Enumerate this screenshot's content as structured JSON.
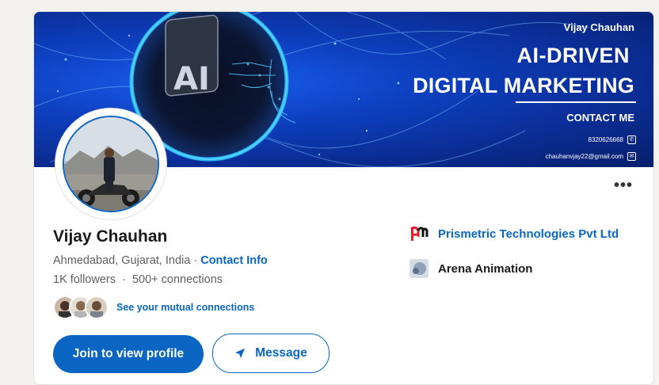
{
  "banner": {
    "name": "Vijay Chauhan",
    "title_line1": "AI-DRIVEN",
    "title_line2": "DIGITAL MARKETING",
    "contact_heading": "CONTACT ME",
    "phone": "8320626668",
    "email": "chauhanvjay22@gmail.com",
    "badge_text": "AI"
  },
  "profile": {
    "name": "Vijay Chauhan",
    "location": "Ahmedabad, Gujarat, India",
    "separator": "·",
    "contact_info_label": "Contact Info",
    "followers": "1K followers",
    "connections": "500+ connections",
    "mutual_link": "See your mutual connections"
  },
  "actions": {
    "join_label": "Join to view profile",
    "message_label": "Message",
    "more_label": "•••"
  },
  "experience": [
    {
      "company": "Prismetric Technologies Pvt Ltd",
      "logo_icon": "prismetric-logo-icon"
    },
    {
      "company": "Arena Animation",
      "logo_icon": "arena-animation-logo-icon"
    }
  ],
  "colors": {
    "accent": "#0a66c2",
    "banner_blue": "#0d3fbf",
    "text_primary": "#191919",
    "text_secondary": "#5f5f5f"
  }
}
